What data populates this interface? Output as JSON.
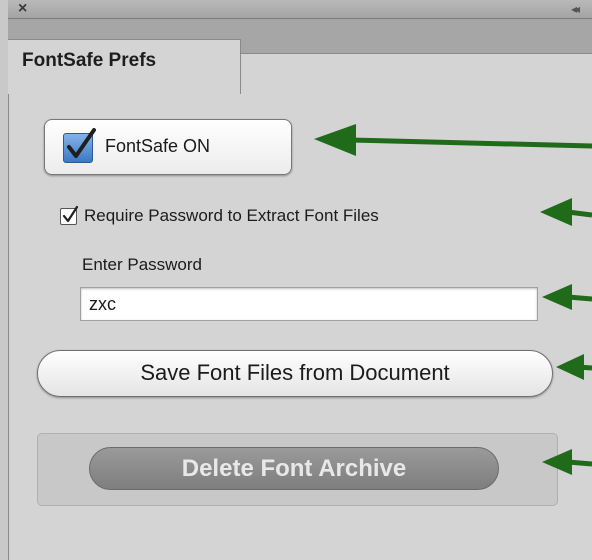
{
  "window": {
    "close_icon": "×",
    "collapse_icon": "◂◂"
  },
  "tab": {
    "label": "FontSafe Prefs"
  },
  "fontsafe": {
    "label": "FontSafe ON",
    "checked": true
  },
  "require_password": {
    "label": "Require Password to Extract Font Files",
    "checked": true
  },
  "password": {
    "label": "Enter Password",
    "value": "zxc"
  },
  "buttons": {
    "save_label": "Save Font Files from Document",
    "delete_label": "Delete Font Archive"
  },
  "colors": {
    "arrow": "#1f6b1a",
    "check_accent": "#3a79c7"
  }
}
